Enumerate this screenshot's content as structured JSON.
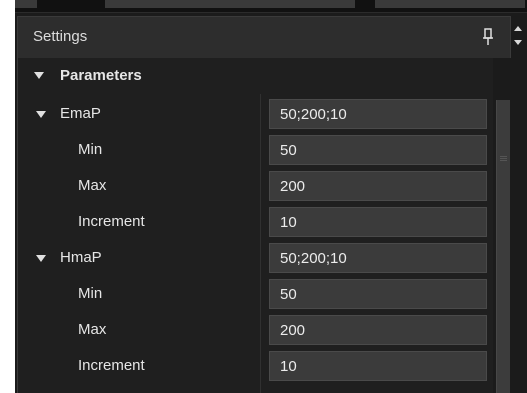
{
  "panel": {
    "title": "Settings",
    "pin_icon": "pin-icon",
    "scroll_icons": [
      "chevron-up-icon",
      "chevron-down-icon"
    ]
  },
  "section": {
    "label": "Parameters",
    "icon": "chevron-down-icon"
  },
  "groups": [
    {
      "label": "EmaP",
      "value": "50;200;10",
      "fields": [
        {
          "label": "Min",
          "value": "50"
        },
        {
          "label": "Max",
          "value": "200"
        },
        {
          "label": "Increment",
          "value": "10"
        }
      ]
    },
    {
      "label": "HmaP",
      "value": "50;200;10",
      "fields": [
        {
          "label": "Min",
          "value": "50"
        },
        {
          "label": "Max",
          "value": "200"
        },
        {
          "label": "Increment",
          "value": "10"
        }
      ]
    }
  ],
  "colors": {
    "background": "#1f1f1f",
    "header": "#2d2d2d",
    "input": "#3b3b3b",
    "text": "#e6e6e6"
  }
}
